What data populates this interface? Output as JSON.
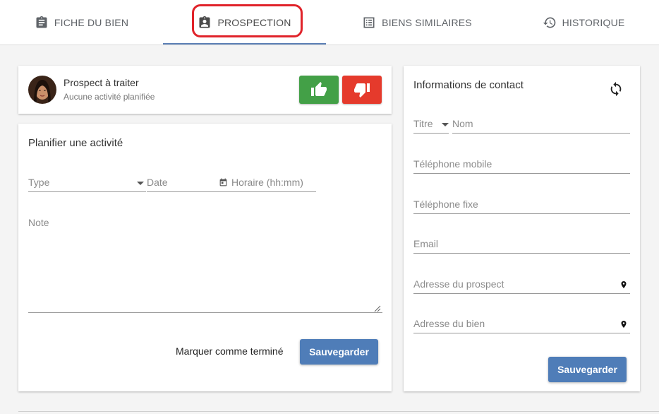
{
  "tabs": [
    {
      "label": "FICHE DU BIEN",
      "icon": "clipboard-icon"
    },
    {
      "label": "PROSPECTION",
      "icon": "contact-badge-icon",
      "active": true
    },
    {
      "label": "BIENS SIMILAIRES",
      "icon": "list-icon"
    },
    {
      "label": "HISTORIQUE",
      "icon": "history-icon"
    }
  ],
  "prospect": {
    "title": "Prospect à traiter",
    "subtitle": "Aucune activité planifiée"
  },
  "activity": {
    "heading": "Planifier une activité",
    "type_placeholder": "Type",
    "date_placeholder": "Date",
    "time_placeholder": "Horaire (hh:mm)",
    "note_placeholder": "Note",
    "mark_done_label": "Marquer comme terminé",
    "save_label": "Sauvegarder"
  },
  "contact": {
    "heading": "Informations de contact",
    "title_placeholder": "Titre",
    "name_placeholder": "Nom",
    "mobile_placeholder": "Téléphone mobile",
    "landline_placeholder": "Téléphone fixe",
    "email_placeholder": "Email",
    "prospect_address_placeholder": "Adresse du prospect",
    "property_address_placeholder": "Adresse du bien",
    "save_label": "Sauvegarder"
  },
  "colors": {
    "like": "#43a047",
    "dislike": "#e53a2c",
    "primary": "#4f7db8",
    "tab_indicator": "#5b7fb5",
    "highlight": "#e0232a"
  }
}
